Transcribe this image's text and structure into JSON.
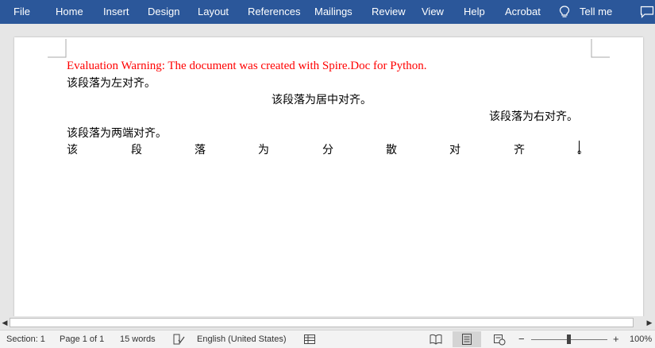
{
  "ribbon": {
    "tabs": [
      "File",
      "Home",
      "Insert",
      "Design",
      "Layout",
      "References",
      "Mailings",
      "Review",
      "View",
      "Help",
      "Acrobat"
    ],
    "tell_me": "Tell me"
  },
  "document": {
    "warning": "Evaluation Warning: The document was created with Spire.Doc for Python.",
    "para_left": "该段落为左对齐。",
    "para_center": "该段落为居中对齐。",
    "para_right": "该段落为右对齐。",
    "para_justify": "该段落为两端对齐。",
    "para_distributed": [
      "该",
      "段",
      "落",
      "为",
      "分",
      "散",
      "对",
      "齐",
      "。"
    ]
  },
  "statusbar": {
    "section": "Section: 1",
    "page": "Page 1 of 1",
    "words": "15 words",
    "language": "English (United States)",
    "zoom_minus": "−",
    "zoom_plus": "+",
    "zoom_level": "100%"
  },
  "colors": {
    "ribbon": "#2b579a",
    "warning_text": "#ff0000",
    "status_bg": "#f3f3f3"
  },
  "icons": [
    "lightbulb-icon",
    "comment-icon",
    "proofing-icon",
    "macro-icon",
    "read-mode-icon",
    "print-layout-icon",
    "web-layout-icon"
  ]
}
